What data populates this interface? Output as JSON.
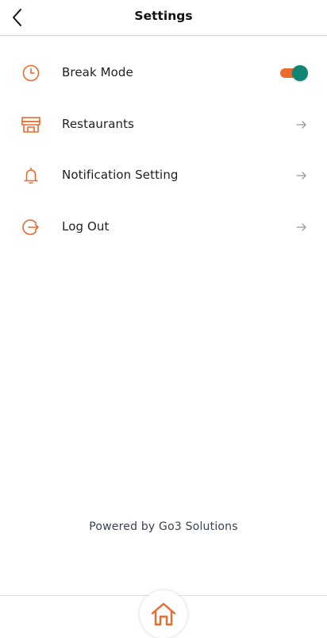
{
  "header": {
    "title": "Settings",
    "back_icon": "chevron-left-icon"
  },
  "menu": {
    "items": [
      {
        "label": "Break Mode",
        "icon": "clock-icon",
        "control": "toggle",
        "toggle_on": true
      },
      {
        "label": "Restaurants",
        "icon": "store-icon",
        "control": "arrow"
      },
      {
        "label": "Notification Setting",
        "icon": "bell-icon",
        "control": "arrow"
      },
      {
        "label": "Log Out",
        "icon": "logout-icon",
        "control": "arrow"
      }
    ]
  },
  "footer": {
    "powered_by": "Powered by Go3 Solutions"
  },
  "bottom_nav": {
    "home_icon": "home-icon"
  },
  "colors": {
    "accent": "#ed6a2c",
    "toggle_knob": "#0f8576",
    "arrow": "#9a9a9a",
    "footer_text": "#3a4350"
  }
}
